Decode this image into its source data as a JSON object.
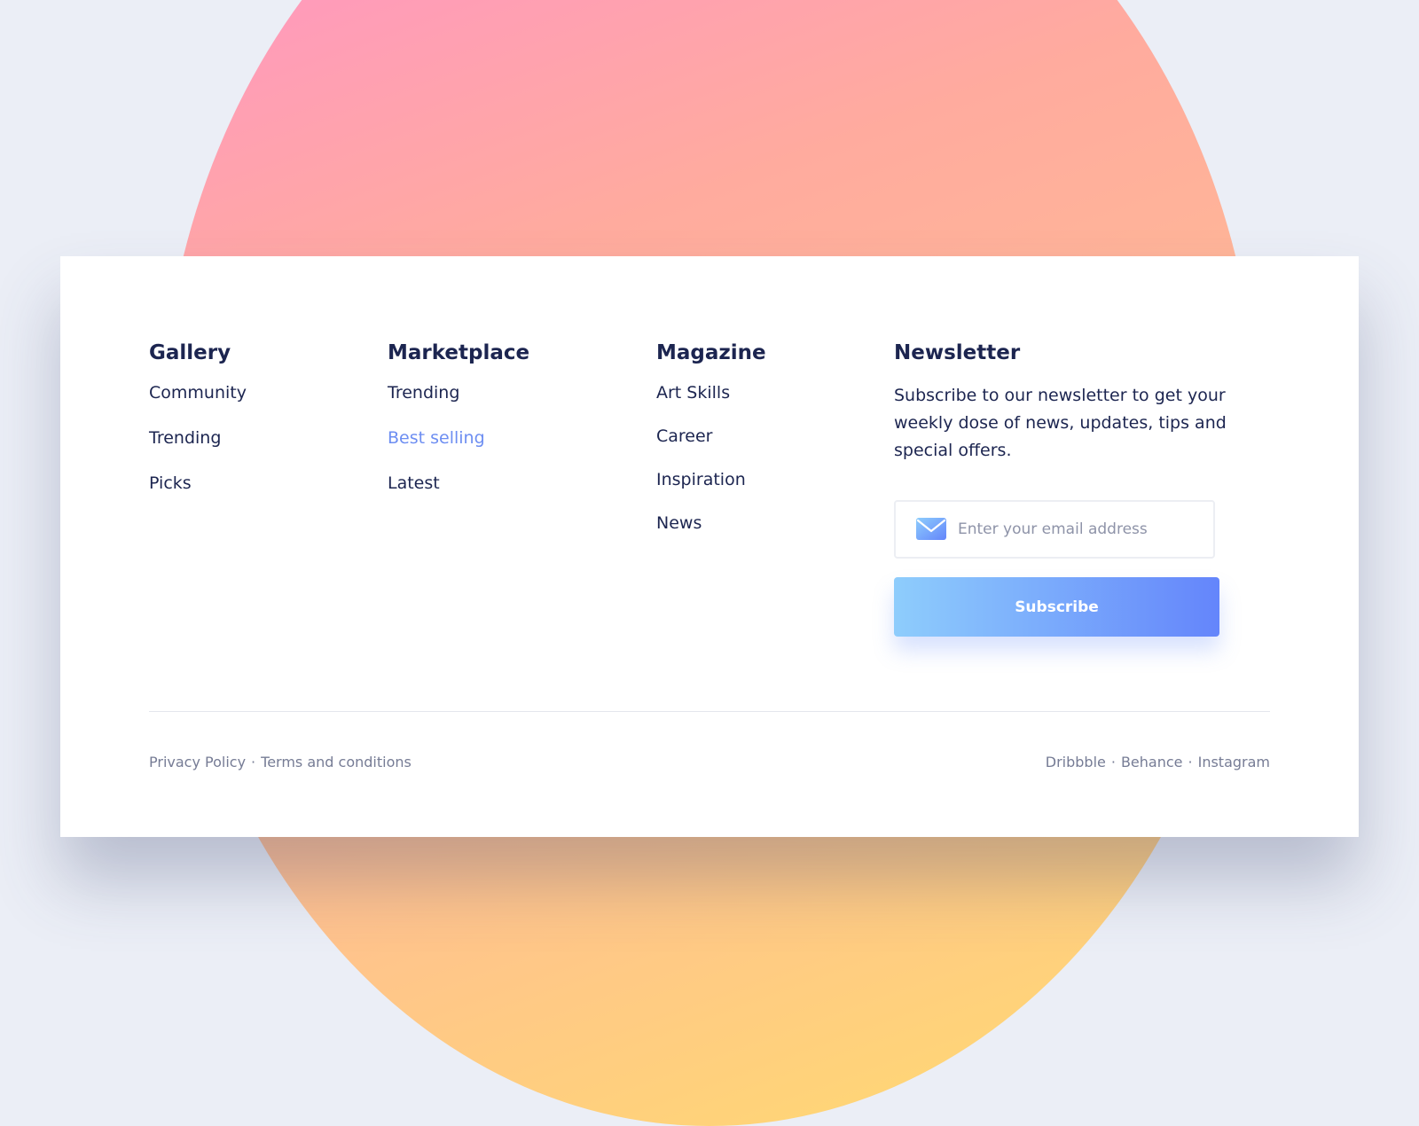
{
  "columns": {
    "gallery": {
      "title": "Gallery",
      "links": [
        "Community",
        "Trending",
        "Picks"
      ]
    },
    "marketplace": {
      "title": "Marketplace",
      "links": [
        "Trending",
        "Best selling",
        "Latest"
      ],
      "active_link": "Best selling"
    },
    "magazine": {
      "title": "Magazine",
      "links": [
        "Art Skills",
        "Career",
        "Inspiration",
        "News"
      ]
    }
  },
  "newsletter": {
    "title": "Newsletter",
    "description": "Subscribe to our newsletter to get your weekly dose of news, updates, tips and special offers.",
    "email_placeholder": "Enter your email address",
    "email_value": "",
    "email_icon": "mail-icon",
    "subscribe_label": "Subscribe"
  },
  "footer": {
    "left_links": [
      "Privacy Policy",
      "Terms and conditions"
    ],
    "right_links": [
      "Dribbble",
      "Behance",
      "Instagram"
    ],
    "separator": "·"
  },
  "colors": {
    "text_dark": "#1c2550",
    "accent_link": "#6d8ef2",
    "muted": "#767c95",
    "button_gradient_start": "#8ecdfc",
    "button_gradient_end": "#6485fb",
    "page_background": "#ebeef6"
  }
}
